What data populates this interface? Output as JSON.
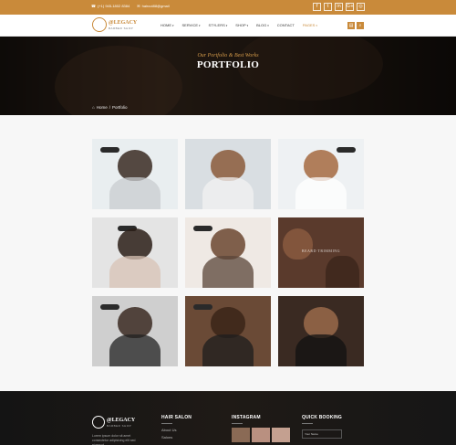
{
  "topbar": {
    "phone": "(+1) 945-1802 8384",
    "email": "haircut88@gmail",
    "socials": [
      "f",
      "t",
      "in",
      "G+",
      "◎"
    ]
  },
  "brand": {
    "name": "@LEGACY",
    "tagline": "BARBER SHOP"
  },
  "menu": [
    {
      "label": "HOME",
      "caret": true,
      "active": false
    },
    {
      "label": "SERVICE",
      "caret": true,
      "active": false
    },
    {
      "label": "STYLERS",
      "caret": true,
      "active": false
    },
    {
      "label": "SHOP",
      "caret": true,
      "active": false
    },
    {
      "label": "BLOG",
      "caret": true,
      "active": false
    },
    {
      "label": "CONTACT",
      "caret": false,
      "active": false
    },
    {
      "label": "PAGES",
      "caret": true,
      "active": true
    }
  ],
  "nav_buttons": {
    "cart_icon": "cart-icon",
    "search_icon": "search-icon"
  },
  "hero": {
    "eyebrow": "Our Portfolio & Best Works",
    "title": "PORTFOLIO",
    "breadcrumb": {
      "home": "Home",
      "separator": "/",
      "current": "Portfolio"
    }
  },
  "gallery": {
    "items": [
      {
        "caption": ""
      },
      {
        "caption": ""
      },
      {
        "caption": ""
      },
      {
        "caption": ""
      },
      {
        "caption": ""
      },
      {
        "caption": "BEARD TRIMMING"
      },
      {
        "caption": ""
      },
      {
        "caption": ""
      },
      {
        "caption": ""
      }
    ]
  },
  "footer": {
    "brand_name": "@LEGACY",
    "brand_tagline": "BARBER SHOP",
    "about_text": "Lorem ipsum dolor sit amet consectetur adipisicing elit sed eiusmod",
    "hair_salon": {
      "heading": "HAIR SALON",
      "links": [
        "About Us",
        "Salons"
      ]
    },
    "instagram": {
      "heading": "INSTAGRAM"
    },
    "quick_booking": {
      "heading": "QUICK BOOKING",
      "field_placeholder": "Your Name"
    }
  },
  "colors": {
    "accent": "#c98a3a",
    "dark": "#141414"
  }
}
